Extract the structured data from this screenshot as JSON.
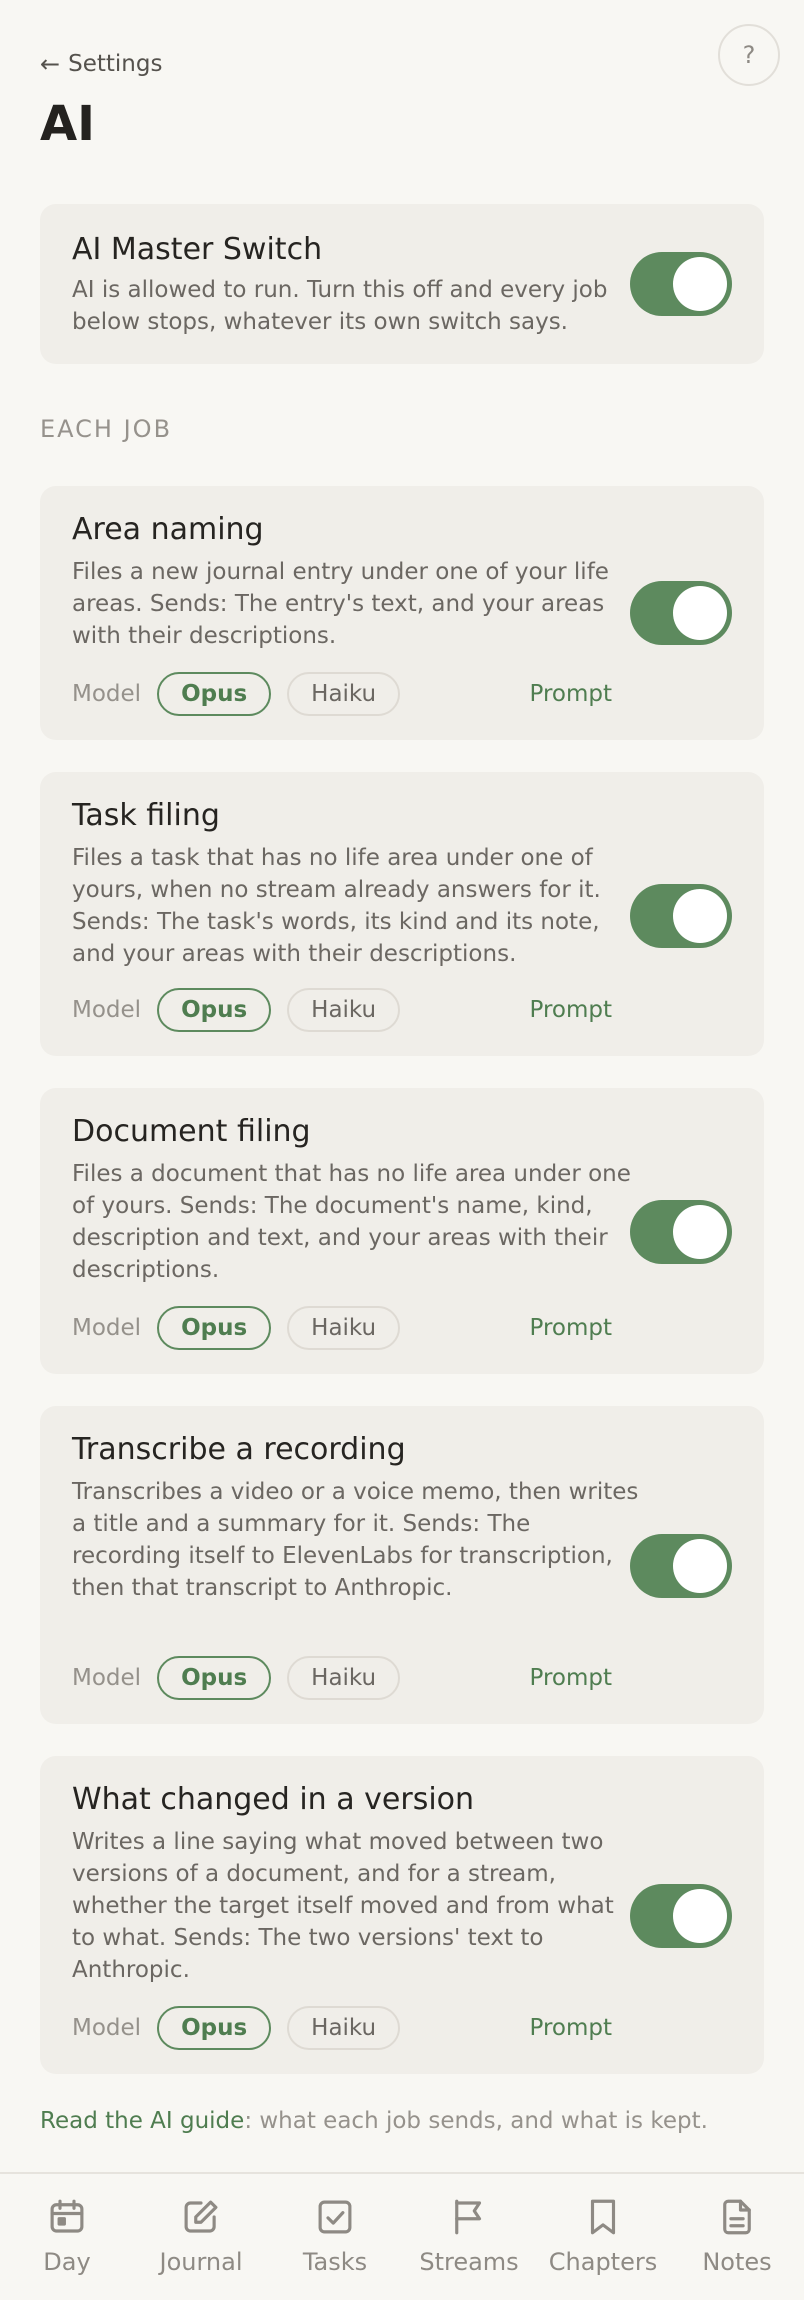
{
  "header": {
    "back_label": "Settings",
    "back_icon": "arrow-left-icon",
    "help_label": "?",
    "title": "AI"
  },
  "master": {
    "title": "AI Master Switch",
    "description": "AI is allowed to run. Turn this off and every job below stops, whatever its own switch says.",
    "enabled": true
  },
  "section_label": "EACH JOB",
  "jobs": [
    {
      "title": "Area naming",
      "description": "Files a new journal entry under one of your life areas. Sends: The entry's text, and your areas with their descriptions.",
      "enabled": true,
      "model_label": "Model",
      "opus": "Opus",
      "haiku": "Haiku",
      "selected": "Opus",
      "prompt": "Prompt"
    },
    {
      "title": "Task filing",
      "description": "Files a task that has no life area under one of yours, when no stream already answers for it. Sends: The task's words, its kind and its note, and your areas with their descriptions.",
      "enabled": true,
      "model_label": "Model",
      "opus": "Opus",
      "haiku": "Haiku",
      "selected": "Opus",
      "prompt": "Prompt"
    },
    {
      "title": "Document filing",
      "description": "Files a document that has no life area under one of yours. Sends: The document's name, kind, description and text, and your areas with their descriptions.",
      "enabled": true,
      "model_label": "Model",
      "opus": "Opus",
      "haiku": "Haiku",
      "selected": "Opus",
      "prompt": "Prompt"
    },
    {
      "title": "Transcribe a recording",
      "description": "Transcribes a video or a voice memo, then writes a title and a summary for it. Sends: The recording itself to ElevenLabs for transcription, then that transcript to Anthropic.",
      "enabled": true,
      "model_label": "Model",
      "opus": "Opus",
      "haiku": "Haiku",
      "selected": "Opus",
      "prompt": "Prompt"
    },
    {
      "title": "What changed in a version",
      "description": "Writes a line saying what moved between two versions of a document, and for a stream, whether the target itself moved and from what to what. Sends: The two versions' text to Anthropic.",
      "enabled": true,
      "model_label": "Model",
      "opus": "Opus",
      "haiku": "Haiku",
      "selected": "Opus",
      "prompt": "Prompt"
    }
  ],
  "guide": {
    "link": "Read the AI guide",
    "rest": ": what each job sends, and what is kept."
  },
  "nav": [
    {
      "label": "Day",
      "icon": "calendar-icon"
    },
    {
      "label": "Journal",
      "icon": "pencil-square-icon"
    },
    {
      "label": "Tasks",
      "icon": "check-square-icon"
    },
    {
      "label": "Streams",
      "icon": "flag-icon"
    },
    {
      "label": "Chapters",
      "icon": "bookmark-icon"
    },
    {
      "label": "Notes",
      "icon": "document-icon"
    }
  ],
  "colors": {
    "accent": "#5d8a5e",
    "link": "#4f7d50",
    "background": "#f8f7f3",
    "card": "#f0eee9"
  }
}
